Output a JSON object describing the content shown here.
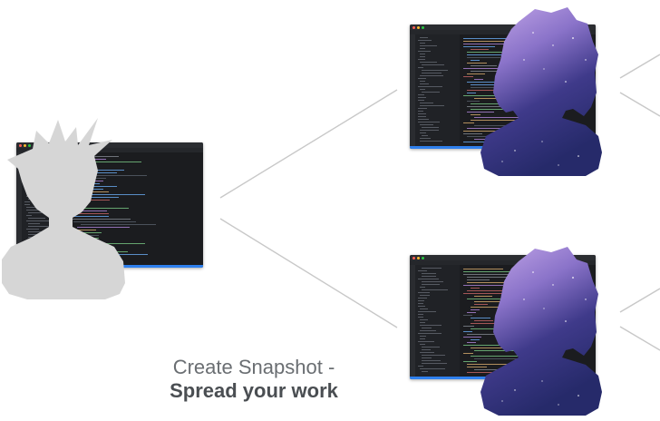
{
  "caption": {
    "line1": "Create Snapshot -",
    "line2": "Spread your work"
  },
  "colors": {
    "connector": "#c8c8c8",
    "silhouette_gray": "#d6d6d6",
    "ide_background": "#1e1f22",
    "status_bar": "#2f80ed",
    "galaxy_dark": "#2a2a6a",
    "galaxy_light": "#b898e0"
  },
  "icons": [
    "person-silhouette-gray",
    "person-silhouette-galaxy",
    "code-editor-window"
  ]
}
